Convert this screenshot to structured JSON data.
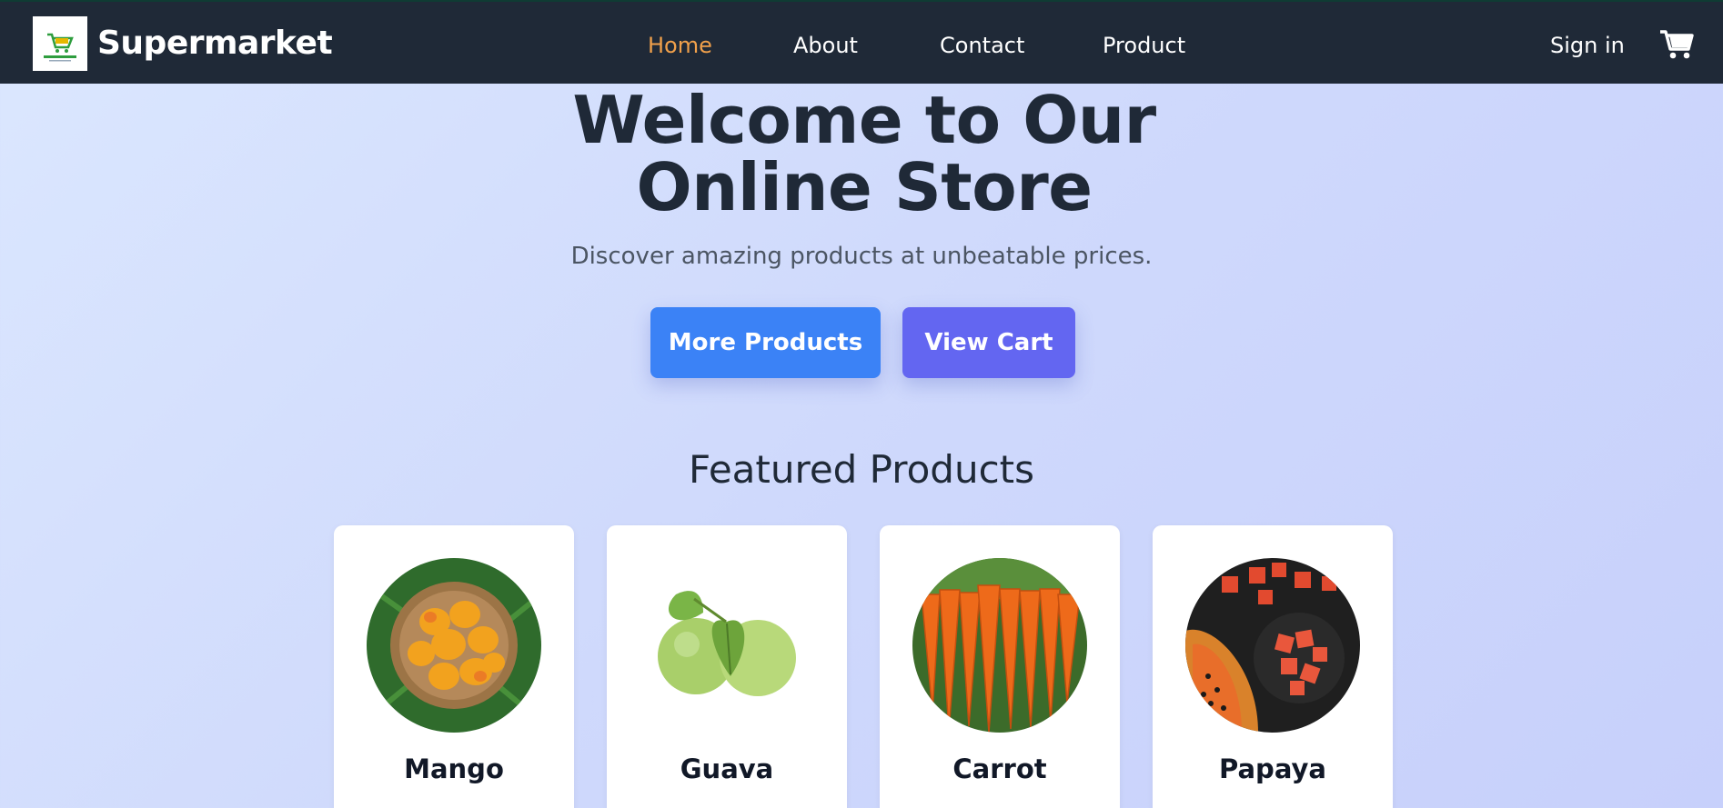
{
  "header": {
    "brand": "Supermarket",
    "logo_icon": "cart-logo-icon",
    "cart_icon": "shopping-cart-icon",
    "nav": [
      {
        "label": "Home",
        "active": true
      },
      {
        "label": "About"
      },
      {
        "label": "Contact"
      },
      {
        "label": "Product"
      }
    ],
    "signin": "Sign in"
  },
  "hero": {
    "title": "Welcome to Our Online Store",
    "subtitle": "Discover amazing products at unbeatable prices.",
    "btn_more": "More Products",
    "btn_cart": "View Cart"
  },
  "featured": {
    "title": "Featured Products",
    "products": [
      {
        "name": "Mango"
      },
      {
        "name": "Guava"
      },
      {
        "name": "Carrot"
      },
      {
        "name": "Papaya"
      }
    ]
  },
  "colors": {
    "nav_bg": "#1f2937",
    "active_link": "#f0a04b",
    "btn_primary": "#3b82f6",
    "btn_secondary": "#6366f1"
  }
}
